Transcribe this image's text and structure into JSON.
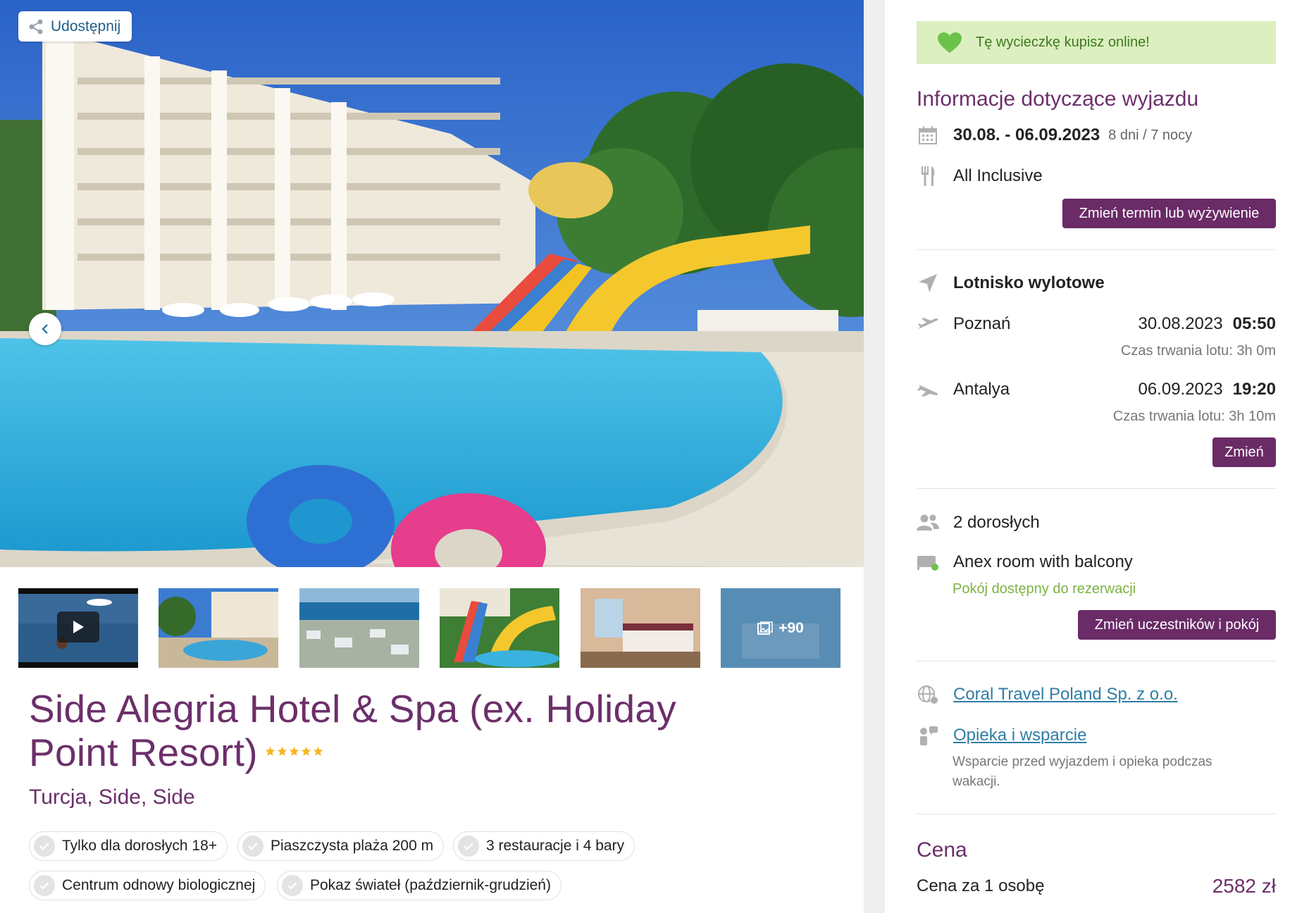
{
  "gallery": {
    "share_label": "Udostępnij",
    "more_label": "+90"
  },
  "hotel": {
    "name": "Side Alegria Hotel & Spa (ex. Holiday Point Resort)",
    "stars": 5,
    "location": "Turcja, Side, Side"
  },
  "features": [
    "Tylko dla dorosłych 18+",
    "Piaszczysta plaża 200 m",
    "3 restauracje i 4 bary",
    "Centrum odnowy biologicznej",
    "Pokaz świateł (październik-grudzień)"
  ],
  "sidebar": {
    "banner": "Tę wycieczkę kupisz online!",
    "trip_info_title": "Informacje dotyczące wyjazdu",
    "dates": "30.08. - 06.09.2023",
    "duration": "8 dni / 7 nocy",
    "board": "All Inclusive",
    "change_term_button": "Zmień termin lub wyżywienie",
    "airport_title": "Lotnisko wylotowe",
    "outbound": {
      "city": "Poznań",
      "date": "30.08.2023",
      "time": "05:50",
      "duration": "Czas trwania lotu: 3h 0m"
    },
    "inbound": {
      "city": "Antalya",
      "date": "06.09.2023",
      "time": "19:20",
      "duration": "Czas trwania lotu: 3h 10m"
    },
    "change_flight_button": "Zmień",
    "participants": "2 dorosłych",
    "room": "Anex room with balcony",
    "room_status": "Pokój dostępny do rezerwacji",
    "change_participants_button": "Zmień uczestników i pokój",
    "operator_link": "Coral Travel Poland Sp. z o.o.",
    "support_link": "Opieka i wsparcie",
    "support_desc": "Wsparcie przed wyjazdem i opieka podczas wakacji.",
    "price_title": "Cena",
    "price_label": "Cena za 1 osobę",
    "price_value": "2582 zł"
  },
  "colors": {
    "brand_purple": "#6c2f6a",
    "button_purple": "#6a2b67",
    "banner_green_bg": "#dcefc0",
    "banner_green_text": "#3e7a1f",
    "available_green": "#7cb342",
    "link_blue": "#2f7ea4"
  }
}
